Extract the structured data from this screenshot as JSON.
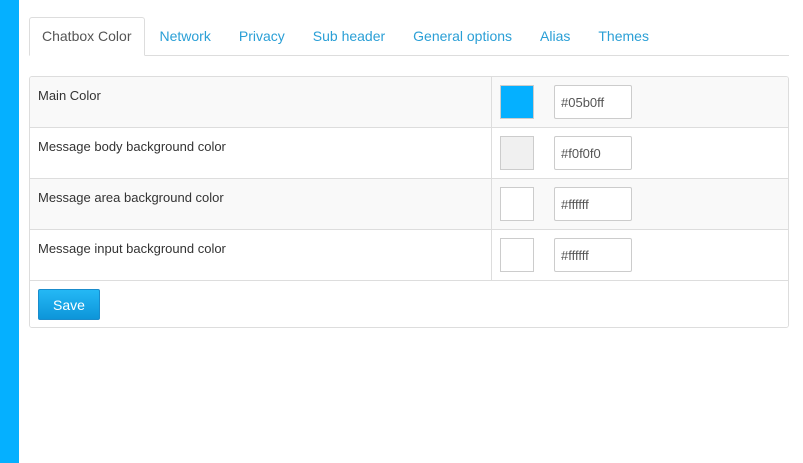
{
  "tabs": [
    {
      "label": "Chatbox Color",
      "active": true
    },
    {
      "label": "Network",
      "active": false
    },
    {
      "label": "Privacy",
      "active": false
    },
    {
      "label": "Sub header",
      "active": false
    },
    {
      "label": "General options",
      "active": false
    },
    {
      "label": "Alias",
      "active": false
    },
    {
      "label": "Themes",
      "active": false
    }
  ],
  "settings": [
    {
      "label": "Main Color",
      "value": "#05b0ff",
      "swatch": "#05b0ff"
    },
    {
      "label": "Message body background color",
      "value": "#f0f0f0",
      "swatch": "#f0f0f0"
    },
    {
      "label": "Message area background color",
      "value": "#ffffff",
      "swatch": "#ffffff"
    },
    {
      "label": "Message input background color",
      "value": "#ffffff",
      "swatch": "#ffffff"
    }
  ],
  "save_label": "Save",
  "colors": {
    "page_background": "#05b0ff",
    "link": "#2a9fd6",
    "button": "#0d95d9"
  }
}
